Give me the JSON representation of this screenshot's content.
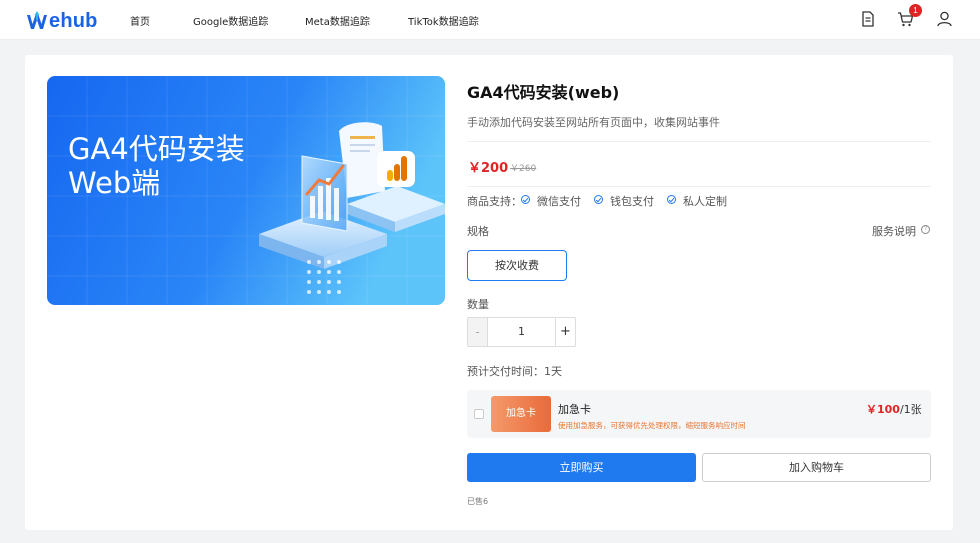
{
  "header": {
    "logo_text": "ehub",
    "nav": [
      "首页",
      "Google数据追踪",
      "Meta数据追踪",
      "TikTok数据追踪"
    ],
    "cart_count": "1",
    "icons": [
      "document-icon",
      "cart-icon",
      "user-icon"
    ]
  },
  "banner": {
    "line1": "GA4代码安装",
    "line2": "Web端"
  },
  "product": {
    "title": "GA4代码安装(web)",
    "description": "手动添加代码安装至网站所有页面中，收集网站事件",
    "price": "￥200",
    "original_price": "￥260",
    "support_label": "商品支持：",
    "support": [
      "微信支付",
      "钱包支付",
      "私人定制"
    ],
    "spec_label": "规格",
    "service_link": "服务说明",
    "spec_option": "按次收费",
    "qty_label": "数量",
    "qty_minus": "-",
    "qty_value": "1",
    "qty_plus": "+",
    "delivery": "预计交付时间：1天"
  },
  "rush": {
    "card_label": "加急卡",
    "name": "加急卡",
    "description": "使用加急服务，可获得优先处理权限，缩短服务响应时间",
    "price": "￥100",
    "unit": "/1张"
  },
  "actions": {
    "buy": "立即购买",
    "add_cart": "加入购物车",
    "sold": "已售6"
  },
  "colors": {
    "primary": "#1f7af0",
    "price": "#e02424",
    "rush": "#e96a3a"
  }
}
